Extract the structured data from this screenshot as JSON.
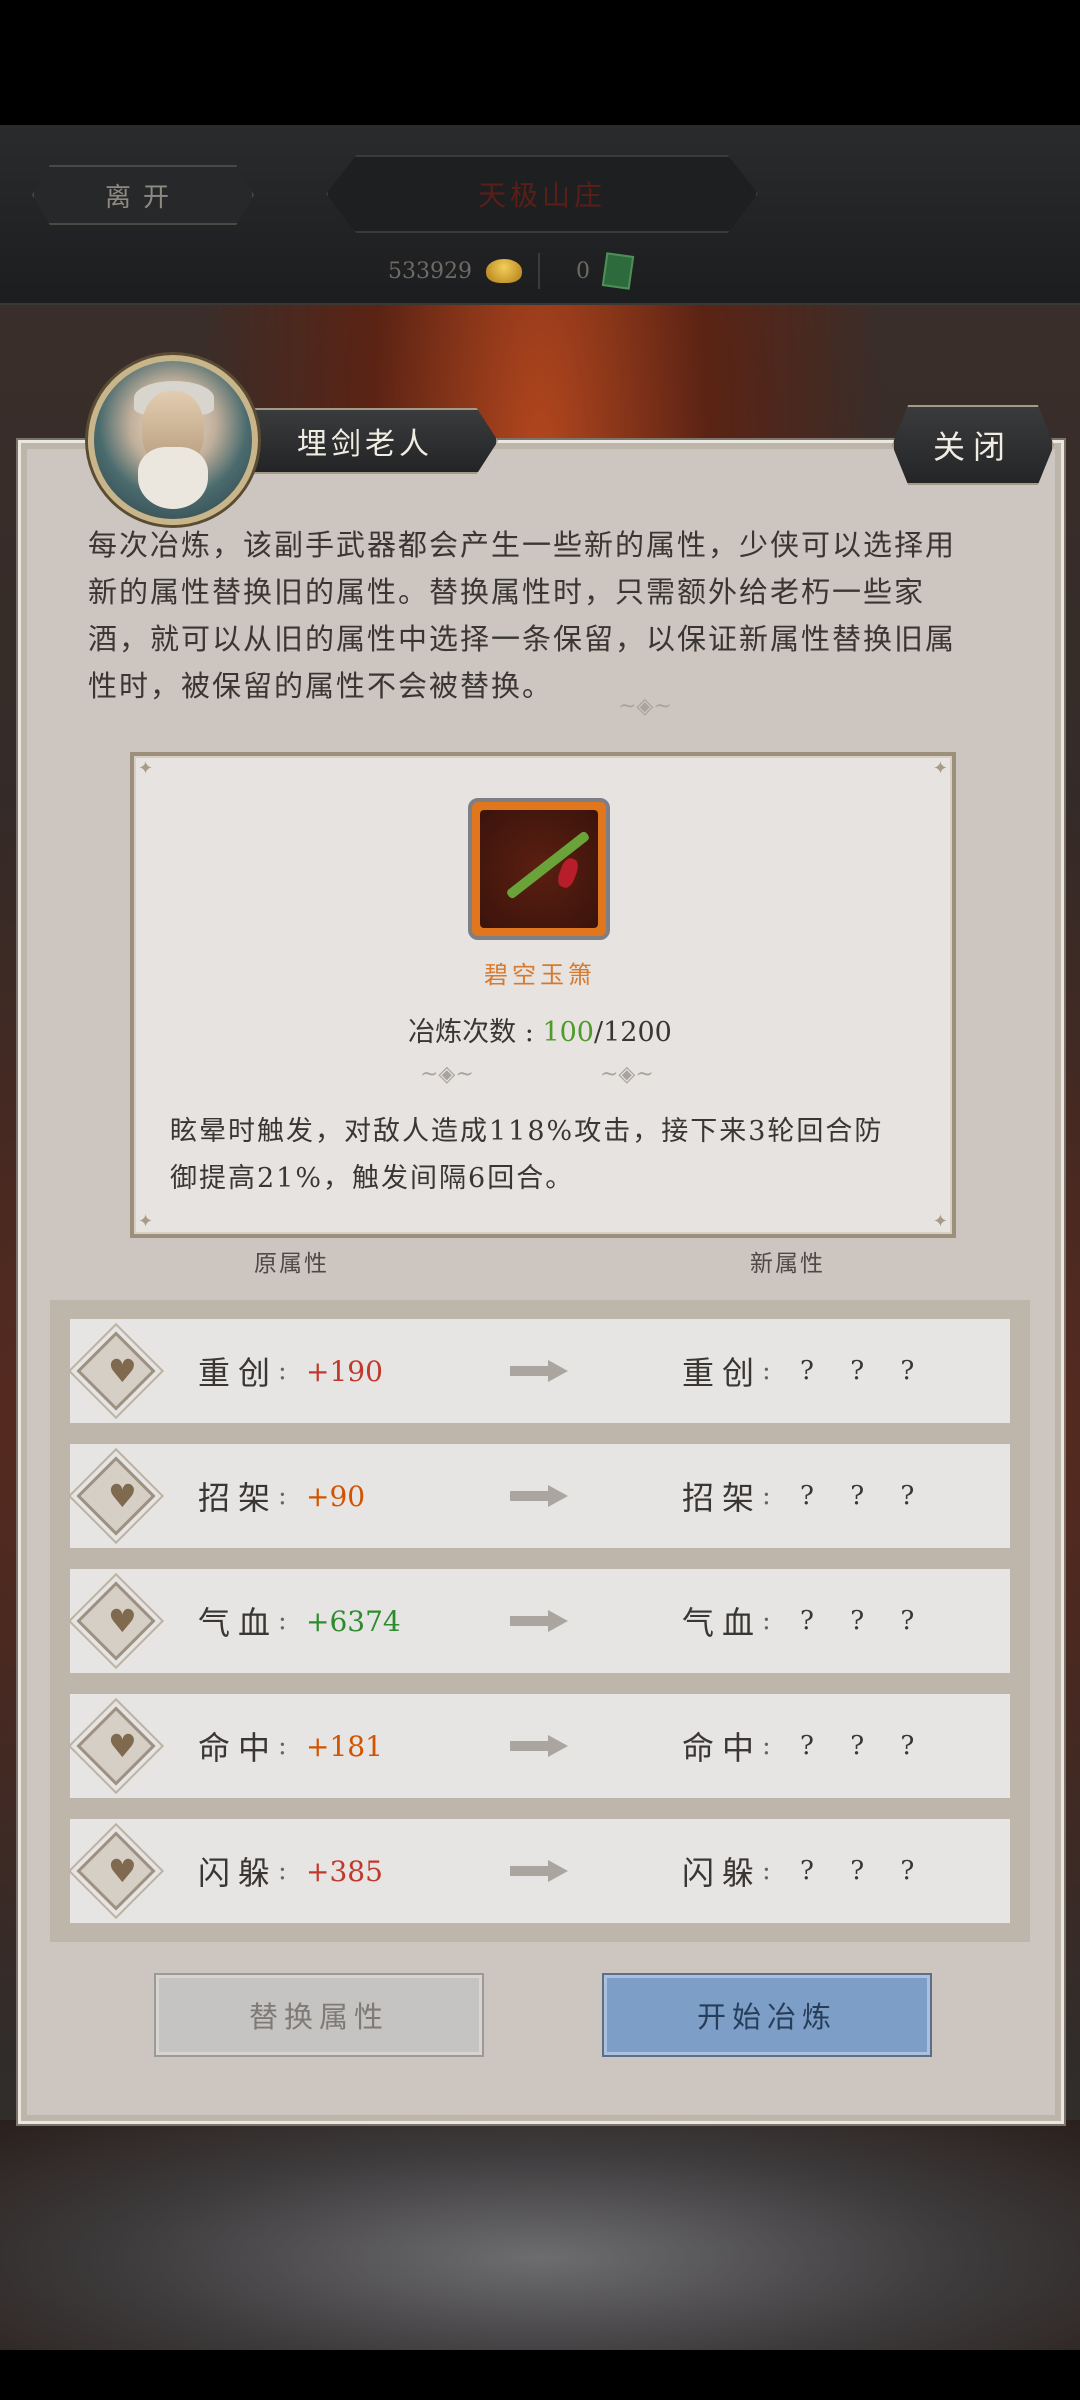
{
  "top_bar": {
    "leave_label": "离开",
    "title": "天极山庄",
    "gold_amount": "533929",
    "jade_amount": "0",
    "gold_icon": "gold-ingot-icon",
    "jade_icon": "jade-token-icon"
  },
  "npc": {
    "name": "埋剑老人",
    "close_label": "关闭"
  },
  "description": "每次冶炼，该副手武器都会产生一些新的属性，少侠可以选择用新的属性替换旧的属性。替换属性时，只需额外给老朽一些家酒，就可以从旧的属性中选择一条保留，以保证新属性替换旧属性时，被保留的属性不会被替换。",
  "item": {
    "name": "碧空玉箫",
    "refine_label": "冶炼次数",
    "refine_current": "100",
    "refine_max": "/1200",
    "skill_text": "眩晕时触发，对敌人造成118%攻击，接下来3轮回合防御提高21%，触发间隔6回合。"
  },
  "columns": {
    "old": "原属性",
    "new": "新属性"
  },
  "attributes": [
    {
      "name": "重创",
      "value": "+190",
      "color": "#c0392b",
      "new_value": "? ? ?"
    },
    {
      "name": "招架",
      "value": "+90",
      "color": "#d35400",
      "new_value": "? ? ?"
    },
    {
      "name": "气血",
      "value": "+6374",
      "color": "#2e8b2e",
      "new_value": "? ? ?"
    },
    {
      "name": "命中",
      "value": "+181",
      "color": "#d35400",
      "new_value": "? ? ?"
    },
    {
      "name": "闪躲",
      "value": "+385",
      "color": "#c0392b",
      "new_value": "? ? ?"
    }
  ],
  "buttons": {
    "replace_label": "替换属性",
    "start_label": "开始冶炼"
  }
}
